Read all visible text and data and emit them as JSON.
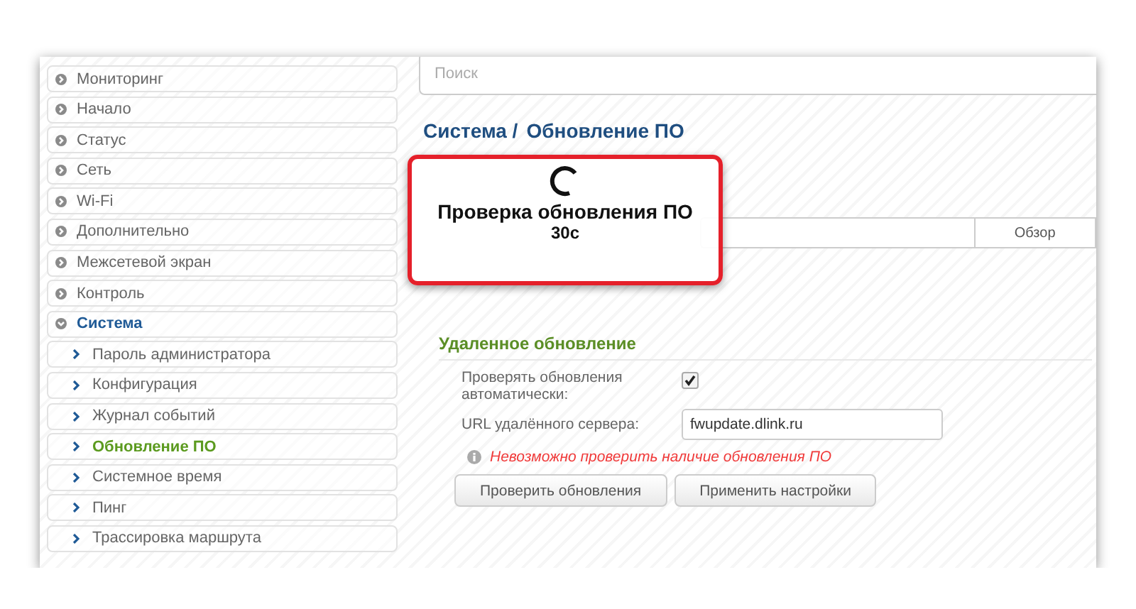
{
  "sidebar": {
    "items": [
      {
        "label": "Мониторинг",
        "expanded": false
      },
      {
        "label": "Начало",
        "expanded": false
      },
      {
        "label": "Статус",
        "expanded": false
      },
      {
        "label": "Сеть",
        "expanded": false
      },
      {
        "label": "Wi-Fi",
        "expanded": false
      },
      {
        "label": "Дополнительно",
        "expanded": false
      },
      {
        "label": "Межсетевой экран",
        "expanded": false
      },
      {
        "label": "Контроль",
        "expanded": false
      },
      {
        "label": "Система",
        "expanded": true,
        "children": [
          {
            "label": "Пароль администратора",
            "selected": false
          },
          {
            "label": "Конфигурация",
            "selected": false
          },
          {
            "label": "Журнал событий",
            "selected": false
          },
          {
            "label": "Обновление ПО",
            "selected": true
          },
          {
            "label": "Системное время",
            "selected": false
          },
          {
            "label": "Пинг",
            "selected": false
          },
          {
            "label": "Трассировка маршрута",
            "selected": false
          }
        ]
      }
    ]
  },
  "search": {
    "placeholder": "Поиск"
  },
  "breadcrumb": {
    "section": "Система /",
    "page": "Обновление ПО"
  },
  "local_update": {
    "browse_button": "Обзор"
  },
  "progress_dialog": {
    "message": "Проверка обновления ПО",
    "countdown": "30с"
  },
  "remote_update": {
    "title": "Удаленное обновление",
    "auto_check": {
      "label": "Проверять обновления автоматически:",
      "checked": true
    },
    "server_url": {
      "label": "URL удалённого сервера:",
      "value": "fwupdate.dlink.ru"
    },
    "error": "Невозможно проверить наличие обновления ПО",
    "buttons": [
      "Проверить обновления",
      "Применить настройки"
    ]
  }
}
